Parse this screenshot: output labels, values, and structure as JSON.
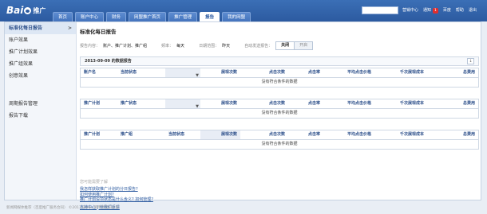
{
  "brand": {
    "logo_text": "Bai",
    "logo_product": "推广"
  },
  "nav": {
    "tabs": [
      "首页",
      "账户中心",
      "财务",
      "网盟推广首页",
      "推广管理",
      "报告",
      "我的网盟"
    ],
    "active_index": 5
  },
  "toplinks": {
    "items": [
      "营销中心",
      "通知",
      "百度",
      "帮助",
      "退出"
    ],
    "notice_count": "1"
  },
  "sidebar": {
    "items": [
      "标准化每日报告",
      "账户效果",
      "推广计划效果",
      "推广组效果",
      "创意效果"
    ],
    "items2": [
      "周期报告管理",
      "报告下载"
    ]
  },
  "main": {
    "title": "标准化每日报告",
    "filters": {
      "content_label": "报告内容：",
      "content_value": "账户、推广计划、推广组",
      "freq_label": "频率：",
      "freq_value": "每天",
      "date_label": "日期范围：",
      "date_value": "昨天",
      "auto_label": "自动发送报告：",
      "toggle_on": "关闭",
      "toggle_off": "开启"
    },
    "date_bar": "2013-09-09 的数据报告",
    "download_icon": "download-icon",
    "empty_text": "没有符合条件的数据",
    "table1_headers": [
      "账户名",
      "当前状态",
      "",
      "展现次数",
      "点击次数",
      "点击率",
      "平均点击价格",
      "千次展现成本",
      "总费用"
    ],
    "table2_headers": [
      "推广计划",
      "推广状态",
      "",
      "展现次数",
      "点击次数",
      "点击率",
      "平均点击价格",
      "千次展现成本",
      "总费用"
    ],
    "table3_headers": [
      "推广计划",
      "推广组",
      "当前状态",
      "展现次数",
      "点击次数",
      "点击率",
      "平均点击价格",
      "千次展现成本",
      "总费用"
    ]
  },
  "help": {
    "header": "您可能需要了解",
    "links": [
      "我怎样获取推广计划的分日报告?",
      "如何使用推广计划?",
      "推广计划设项状态是什么含义? 如何管理?"
    ],
    "support": "支持中心 | 给我们反馈"
  },
  "footer": "新闻网媒体推荐（百度推广服务合同）  ©2013 Baidu 使用百度前必读"
}
